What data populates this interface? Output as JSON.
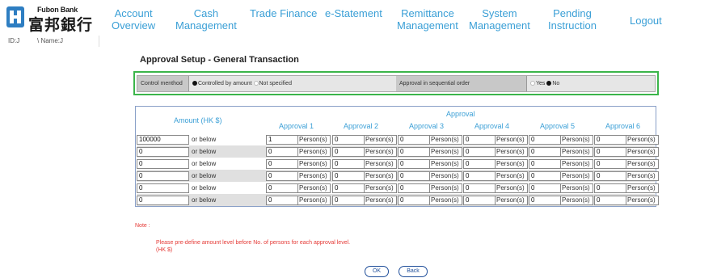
{
  "logo": {
    "en": "Fubon Bank",
    "zh": "富邦銀行"
  },
  "nav": [
    {
      "label": "Account\nOverview"
    },
    {
      "label": "Cash\nManagement"
    },
    {
      "label": "Trade Finance"
    },
    {
      "label": "e-Statement"
    },
    {
      "label": "Remittance\nManagement"
    },
    {
      "label": "System\nManagement"
    },
    {
      "label": "Pending\nInstruction"
    },
    {
      "label": "Logout"
    }
  ],
  "idbar": {
    "id_label": "ID:J",
    "name_label": "\\ Name:J"
  },
  "page_title": "Approval Setup - General Transaction",
  "control": {
    "method_label": "Control menthod",
    "option_amount": "Controlled by amount",
    "option_not_specified": "Not specified",
    "sequential_label": "Approval in sequential order",
    "option_yes": "Yes",
    "option_no": "No"
  },
  "table": {
    "amount_header": "Amount (HK $)",
    "approval_header": "Approval",
    "approval_cols": [
      "Approval 1",
      "Approval 2",
      "Approval 3",
      "Approval 4",
      "Approval 5",
      "Approval 6"
    ],
    "or_below": "or below",
    "persons_label": "Person(s)",
    "rows": [
      {
        "amount": "100000",
        "approvals": [
          "1",
          "0",
          "0",
          "0",
          "0",
          "0"
        ]
      },
      {
        "amount": "0",
        "approvals": [
          "0",
          "0",
          "0",
          "0",
          "0",
          "0"
        ]
      },
      {
        "amount": "0",
        "approvals": [
          "0",
          "0",
          "0",
          "0",
          "0",
          "0"
        ]
      },
      {
        "amount": "0",
        "approvals": [
          "0",
          "0",
          "0",
          "0",
          "0",
          "0"
        ]
      },
      {
        "amount": "0",
        "approvals": [
          "0",
          "0",
          "0",
          "0",
          "0",
          "0"
        ]
      },
      {
        "amount": "0",
        "approvals": [
          "0",
          "0",
          "0",
          "0",
          "0",
          "0"
        ]
      }
    ]
  },
  "note": {
    "label": "Note :",
    "line1": "Please pre-define amount level before No. of persons for each approval level.",
    "line2": "(HK $)"
  },
  "buttons": {
    "ok": "OK",
    "back": "Back"
  },
  "colors": {
    "nav": "#3a9fd6",
    "highlight_border": "#3bb54a",
    "note": "#e53935",
    "button": "#1f4e9a"
  }
}
